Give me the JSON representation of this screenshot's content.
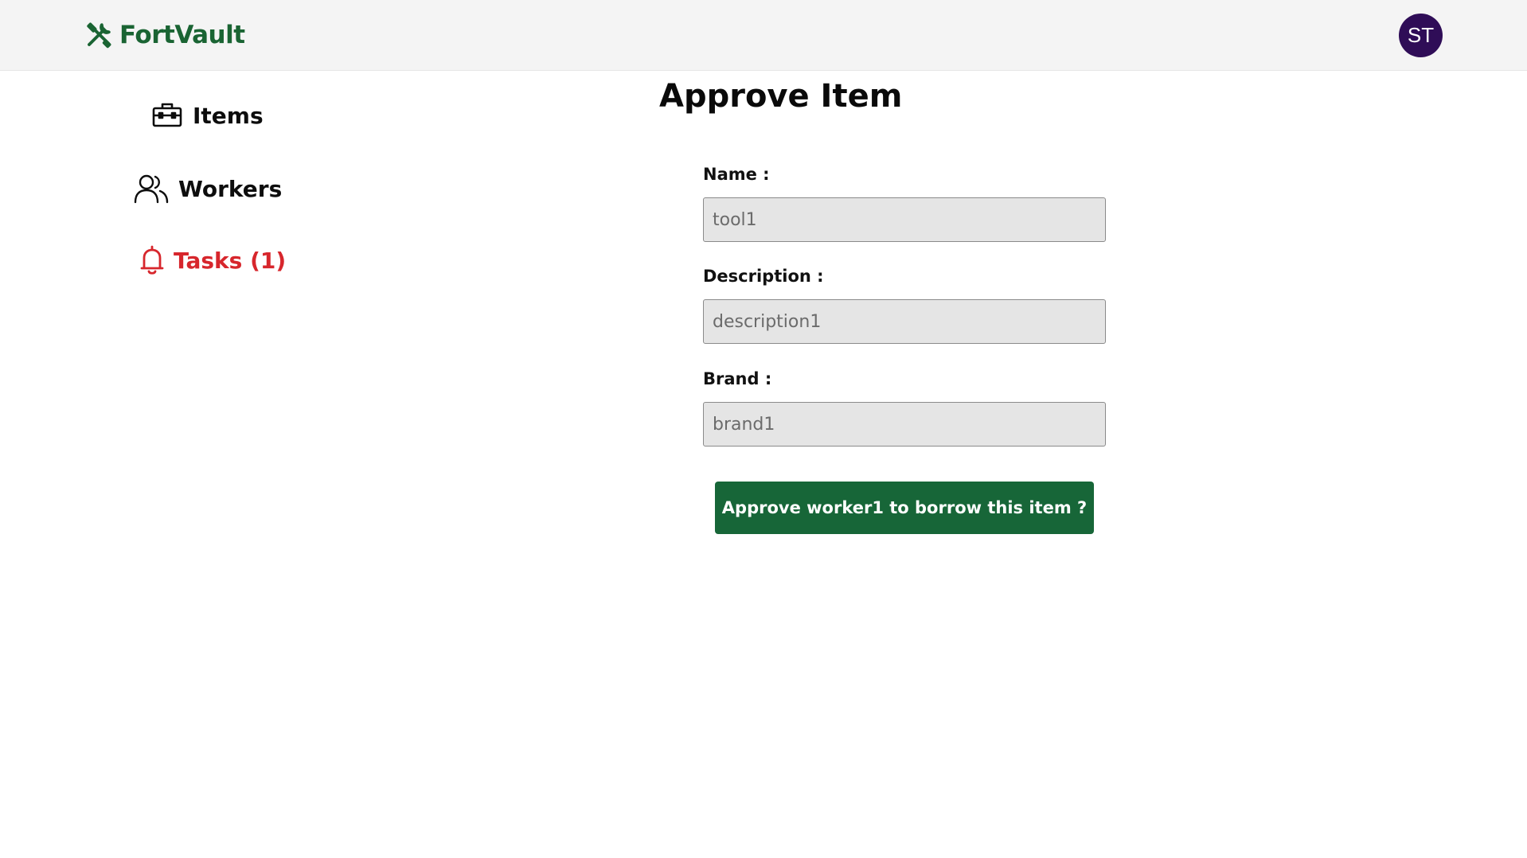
{
  "header": {
    "brand": "FortVault",
    "brand_color": "#1a6433",
    "logo_icon": "tools-icon",
    "avatar_initials": "ST",
    "avatar_color": "#2f0d57"
  },
  "sidebar": {
    "items": [
      {
        "label": "Items",
        "icon": "toolbox-icon",
        "color": "#0d0d0d"
      },
      {
        "label": "Workers",
        "icon": "users-icon",
        "color": "#0d0d0d"
      },
      {
        "label": "Tasks (1)",
        "icon": "bell-icon",
        "color": "#d7262c"
      }
    ]
  },
  "main": {
    "title": "Approve Item",
    "fields": [
      {
        "label": "Name :",
        "value": "",
        "placeholder": "tool1"
      },
      {
        "label": "Description :",
        "value": "",
        "placeholder": "description1"
      },
      {
        "label": "Brand :",
        "value": "",
        "placeholder": "brand1"
      }
    ],
    "approve_button_label": "Approve worker1 to borrow this item ?",
    "approve_button_color": "#176638"
  }
}
